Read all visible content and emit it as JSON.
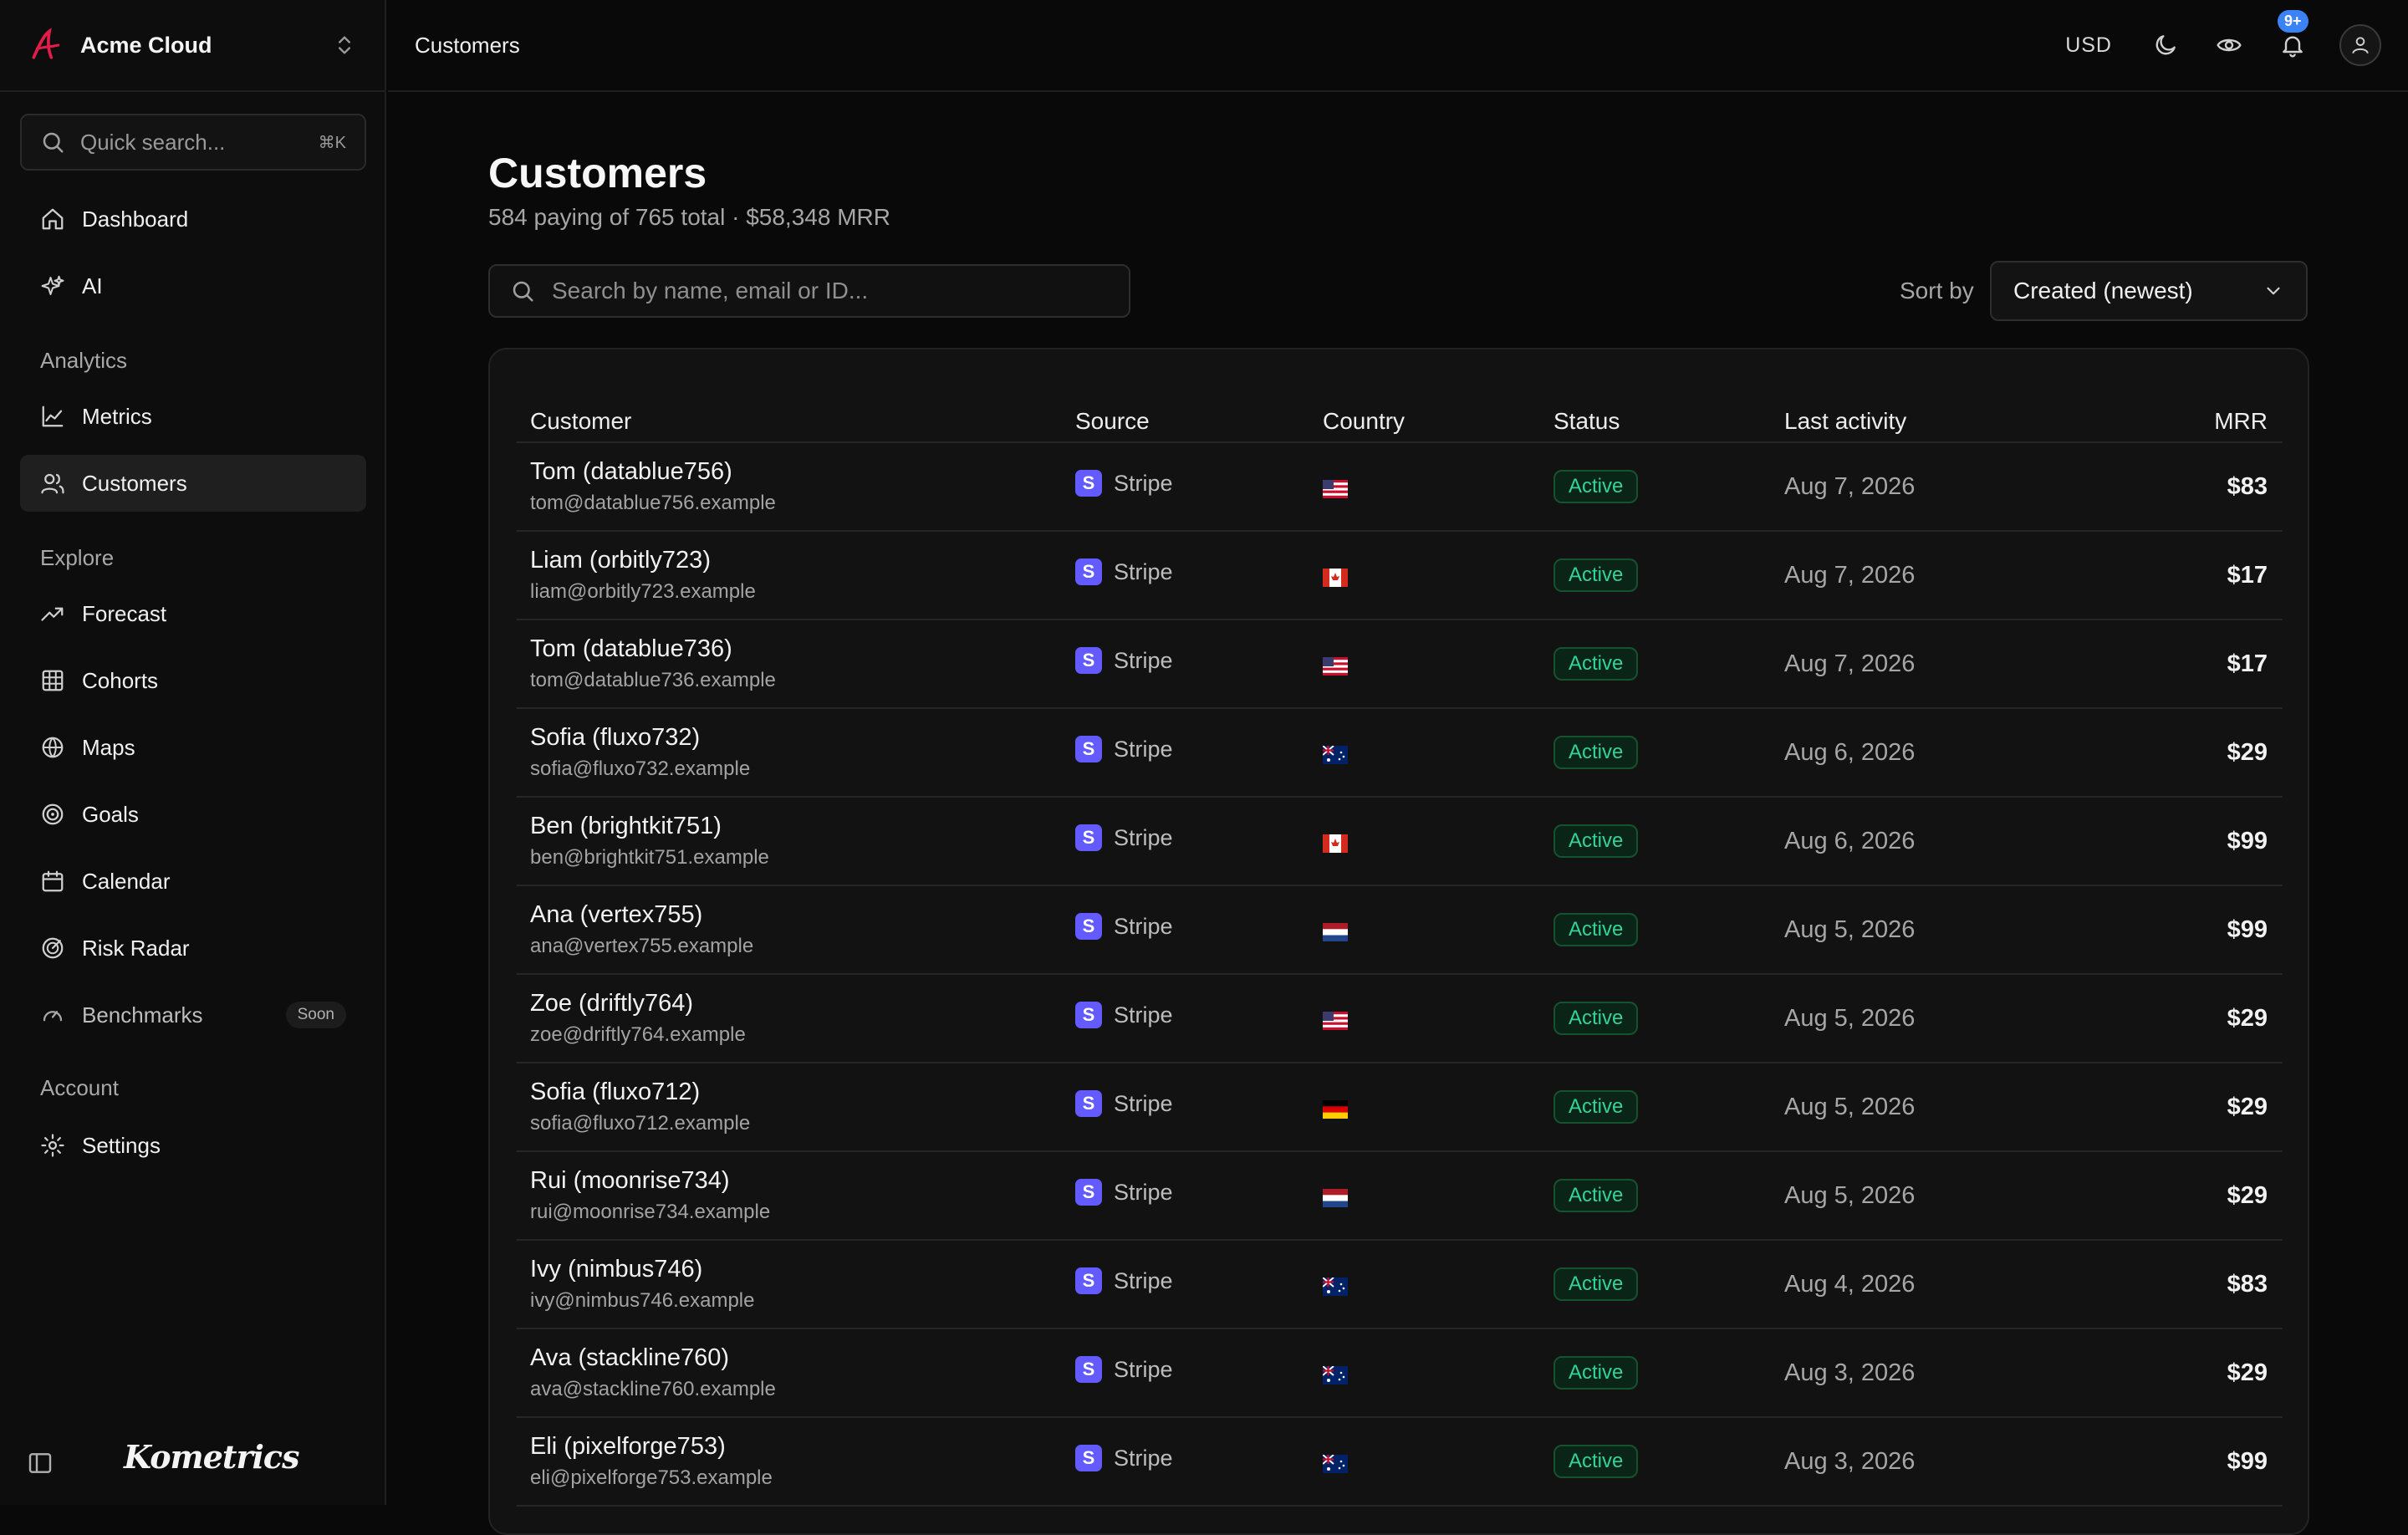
{
  "brand": {
    "name": "Acme Cloud",
    "wordmark": "Kometrics"
  },
  "quick_search": {
    "placeholder": "Quick search...",
    "shortcut": "⌘K"
  },
  "nav": {
    "top": [
      {
        "label": "Dashboard",
        "icon": "home-icon"
      },
      {
        "label": "AI",
        "icon": "sparkles-icon"
      }
    ],
    "analytics_title": "Analytics",
    "analytics": [
      {
        "label": "Metrics",
        "icon": "line-chart-icon"
      },
      {
        "label": "Customers",
        "icon": "users-icon",
        "active": true
      }
    ],
    "explore_title": "Explore",
    "explore": [
      {
        "label": "Forecast",
        "icon": "trending-up-icon"
      },
      {
        "label": "Cohorts",
        "icon": "grid-icon"
      },
      {
        "label": "Maps",
        "icon": "globe-icon"
      },
      {
        "label": "Goals",
        "icon": "target-icon"
      },
      {
        "label": "Calendar",
        "icon": "calendar-icon"
      },
      {
        "label": "Risk Radar",
        "icon": "radar-icon"
      },
      {
        "label": "Benchmarks",
        "icon": "gauge-icon",
        "badge": "Soon"
      }
    ],
    "account_title": "Account",
    "account": [
      {
        "label": "Settings",
        "icon": "gear-icon"
      }
    ]
  },
  "topbar": {
    "breadcrumb": "Customers",
    "currency": "USD",
    "notifications_badge": "9+"
  },
  "page": {
    "title": "Customers",
    "subtitle": "584 paying of 765 total · $58,348 MRR",
    "search_placeholder": "Search by name, email or ID...",
    "sort_label": "Sort by",
    "sort_value": "Created (newest)"
  },
  "table": {
    "columns": [
      "Customer",
      "Source",
      "Country",
      "Status",
      "Last activity",
      "MRR"
    ],
    "rows": [
      {
        "name": "Tom (datablue756)",
        "email": "tom@datablue756.example",
        "source": "Stripe",
        "country": "us",
        "status": "Active",
        "last_activity": "Aug 7, 2026",
        "mrr": "$83"
      },
      {
        "name": "Liam (orbitly723)",
        "email": "liam@orbitly723.example",
        "source": "Stripe",
        "country": "ca",
        "status": "Active",
        "last_activity": "Aug 7, 2026",
        "mrr": "$17"
      },
      {
        "name": "Tom (datablue736)",
        "email": "tom@datablue736.example",
        "source": "Stripe",
        "country": "us",
        "status": "Active",
        "last_activity": "Aug 7, 2026",
        "mrr": "$17"
      },
      {
        "name": "Sofia (fluxo732)",
        "email": "sofia@fluxo732.example",
        "source": "Stripe",
        "country": "au",
        "status": "Active",
        "last_activity": "Aug 6, 2026",
        "mrr": "$29"
      },
      {
        "name": "Ben (brightkit751)",
        "email": "ben@brightkit751.example",
        "source": "Stripe",
        "country": "ca",
        "status": "Active",
        "last_activity": "Aug 6, 2026",
        "mrr": "$99"
      },
      {
        "name": "Ana (vertex755)",
        "email": "ana@vertex755.example",
        "source": "Stripe",
        "country": "nl",
        "status": "Active",
        "last_activity": "Aug 5, 2026",
        "mrr": "$99"
      },
      {
        "name": "Zoe (driftly764)",
        "email": "zoe@driftly764.example",
        "source": "Stripe",
        "country": "us",
        "status": "Active",
        "last_activity": "Aug 5, 2026",
        "mrr": "$29"
      },
      {
        "name": "Sofia (fluxo712)",
        "email": "sofia@fluxo712.example",
        "source": "Stripe",
        "country": "de",
        "status": "Active",
        "last_activity": "Aug 5, 2026",
        "mrr": "$29"
      },
      {
        "name": "Rui (moonrise734)",
        "email": "rui@moonrise734.example",
        "source": "Stripe",
        "country": "nl",
        "status": "Active",
        "last_activity": "Aug 5, 2026",
        "mrr": "$29"
      },
      {
        "name": "Ivy (nimbus746)",
        "email": "ivy@nimbus746.example",
        "source": "Stripe",
        "country": "au",
        "status": "Active",
        "last_activity": "Aug 4, 2026",
        "mrr": "$83"
      },
      {
        "name": "Ava (stackline760)",
        "email": "ava@stackline760.example",
        "source": "Stripe",
        "country": "au",
        "status": "Active",
        "last_activity": "Aug 3, 2026",
        "mrr": "$29"
      },
      {
        "name": "Eli (pixelforge753)",
        "email": "eli@pixelforge753.example",
        "source": "Stripe",
        "country": "au",
        "status": "Active",
        "last_activity": "Aug 3, 2026",
        "mrr": "$99"
      }
    ]
  },
  "colors": {
    "accent_brand": "#e11d48",
    "stripe": "#635bff",
    "status_active": "#34d399",
    "badge": "#3b82f6"
  }
}
